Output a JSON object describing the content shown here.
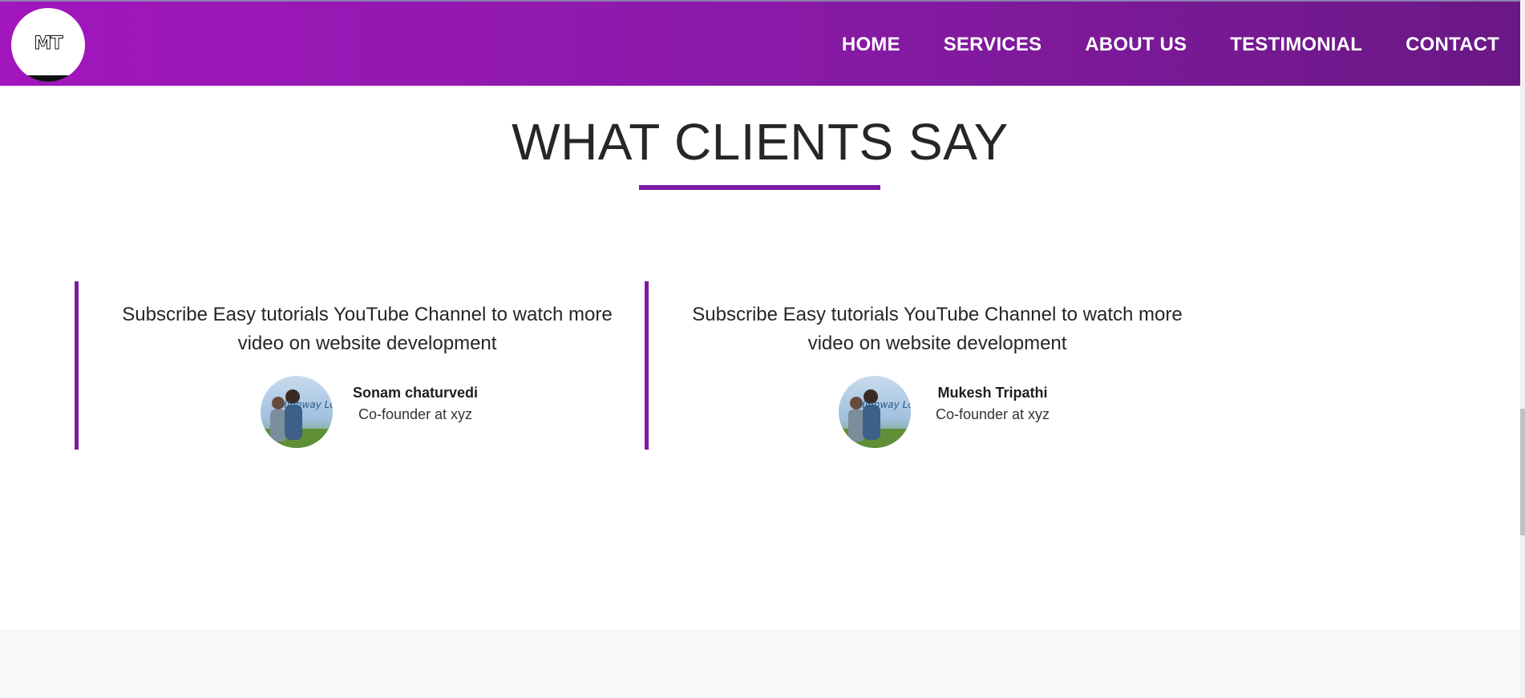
{
  "header": {
    "logo_text": "MT",
    "nav": [
      "HOME",
      "SERVICES",
      "ABOUT US",
      "TESTIMONIAL",
      "CONTACT"
    ]
  },
  "section": {
    "title": "WHAT CLIENTS SAY"
  },
  "testimonials": [
    {
      "quote": "Subscribe Easy tutorials YouTube Channel to watch more video on website development",
      "name": "Sonam chaturvedi",
      "role": "Co-founder at xyz",
      "avatar_text": "Highway Love"
    },
    {
      "quote": "Subscribe Easy tutorials YouTube Channel to watch more video on website development",
      "name": "Mukesh Tripathi",
      "role": "Co-founder at xyz",
      "avatar_text": "Highway Love"
    }
  ],
  "colors": {
    "accent": "#7d1aa0",
    "header_start": "#a216bd",
    "header_end": "#6a1885",
    "footer_band": "#f7f8f9"
  }
}
